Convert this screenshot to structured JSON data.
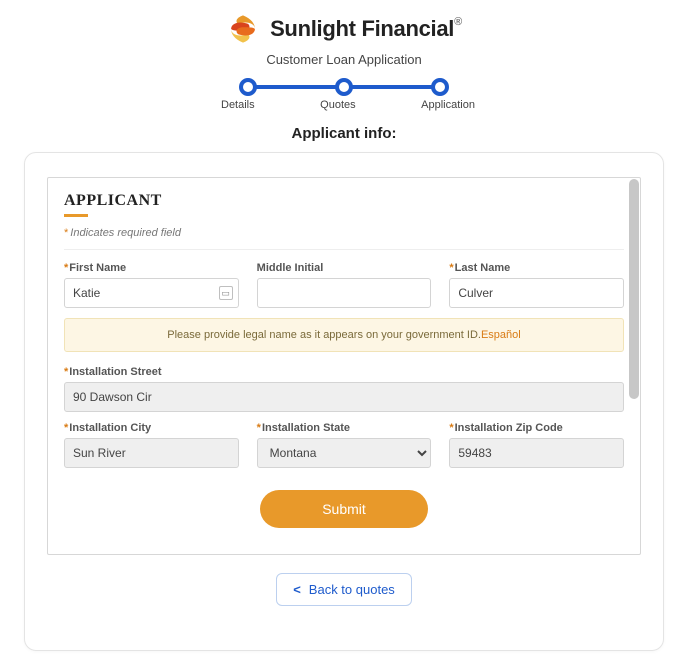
{
  "brand": {
    "name": "Sunlight Financial",
    "subtitle": "Customer Loan Application"
  },
  "stepper": {
    "steps": [
      "Details",
      "Quotes",
      "Application"
    ]
  },
  "section_title": "Applicant info:",
  "form": {
    "heading": "APPLICANT",
    "required_note": "Indicates required field",
    "fields": {
      "first_name": {
        "label": "First Name",
        "value": "Katie",
        "required": true
      },
      "middle_initial": {
        "label": "Middle Initial",
        "value": "",
        "required": false
      },
      "last_name": {
        "label": "Last Name",
        "value": "Culver",
        "required": true
      },
      "install_street": {
        "label": "Installation Street",
        "value": "90 Dawson Cir",
        "required": true
      },
      "install_city": {
        "label": "Installation City",
        "value": "Sun River",
        "required": true
      },
      "install_state": {
        "label": "Installation State",
        "value": "Montana",
        "required": true
      },
      "install_zip": {
        "label": "Installation Zip Code",
        "value": "59483",
        "required": true
      }
    },
    "notice": {
      "text": "Please provide legal name as it appears on your government ID.",
      "link_label": "Español"
    },
    "submit_label": "Submit"
  },
  "back_button": {
    "label": "Back to quotes"
  }
}
